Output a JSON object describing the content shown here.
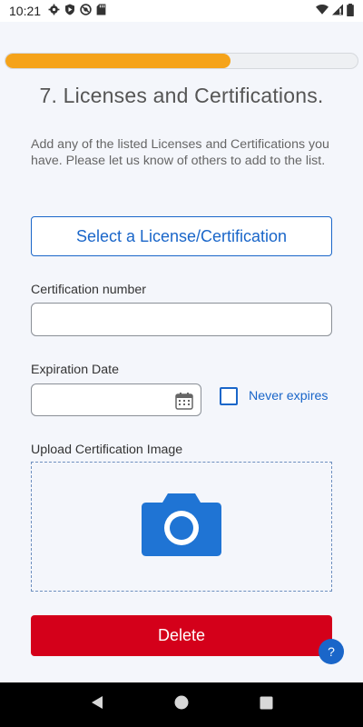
{
  "status_bar": {
    "time": "10:21",
    "left_icons": [
      "gear-icon",
      "play-protect-icon",
      "no-sync-icon",
      "sd-card-icon"
    ],
    "right_icons": [
      "wifi-icon",
      "signal-icon",
      "battery-icon"
    ]
  },
  "progress": {
    "fraction": 0.64,
    "color": "#f5a31a"
  },
  "page": {
    "title": "7. Licenses and Certifications.",
    "description": "Add any of the listed Licenses and Certifications you have. Please let us know of others to add to the list."
  },
  "form": {
    "select_button_label": "Select a License/Certification",
    "certification_number_label": "Certification number",
    "certification_number_value": "",
    "expiration_date_label": "Expiration Date",
    "expiration_date_value": "",
    "never_expires_label": "Never expires",
    "never_expires_checked": false,
    "upload_label": "Upload Certification Image",
    "upload_icon": "camera-icon",
    "delete_button_label": "Delete",
    "help_label": "?"
  },
  "nav_bar": {
    "buttons": [
      "back-icon",
      "home-icon",
      "recents-icon"
    ]
  },
  "colors": {
    "accent": "#1a66c9",
    "delete": "#d4001a",
    "progress": "#f5a31a"
  }
}
